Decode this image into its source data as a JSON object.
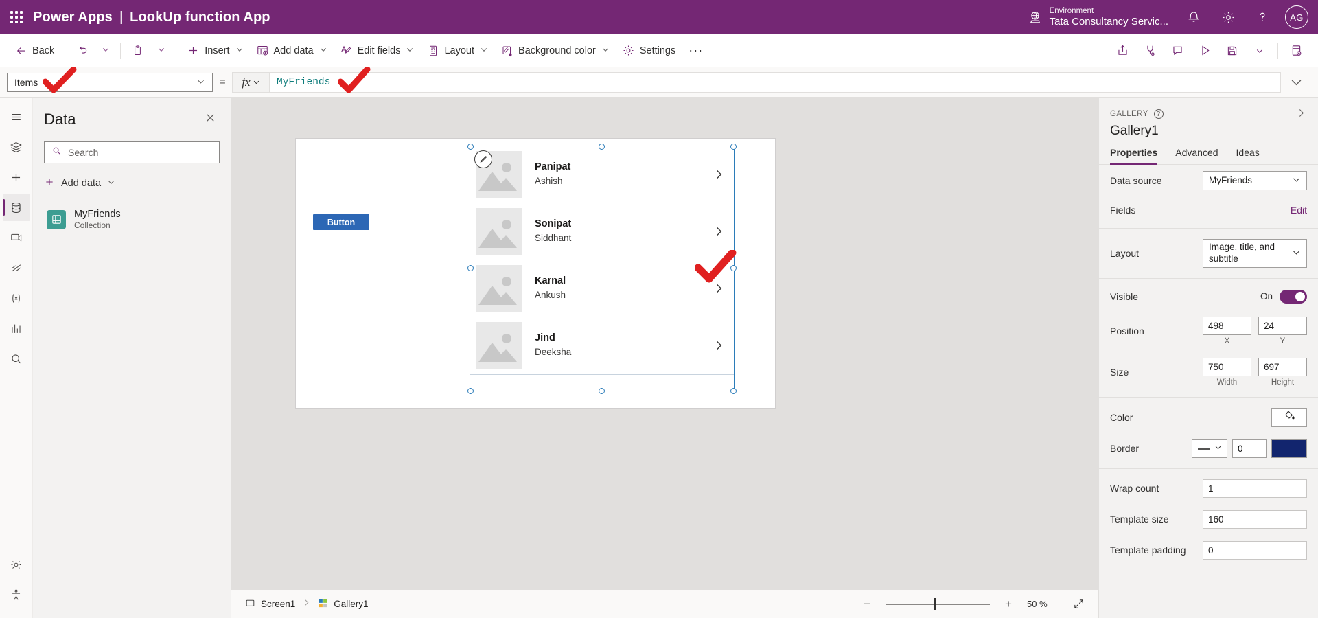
{
  "header": {
    "waffle": "app-launcher",
    "product": "Power Apps",
    "separator": "|",
    "app_name": "LookUp function App",
    "environment_label": "Environment",
    "environment_name": "Tata Consultancy Servic...",
    "avatar_initials": "AG",
    "brand_color": "#742774"
  },
  "ribbon": {
    "back": "Back",
    "items": [
      {
        "label": "Insert",
        "icon": "plus-icon",
        "caret": true
      },
      {
        "label": "Add data",
        "icon": "add-data-icon",
        "caret": true
      },
      {
        "label": "Edit fields",
        "icon": "edit-fields-icon",
        "caret": true
      },
      {
        "label": "Layout",
        "icon": "layout-icon",
        "caret": true
      },
      {
        "label": "Background color",
        "icon": "background-color-icon",
        "caret": true
      },
      {
        "label": "Settings",
        "icon": "settings-gear-icon",
        "caret": false
      }
    ],
    "overflow": "···"
  },
  "formula_bar": {
    "property": "Items",
    "equals": "=",
    "fx": "fx",
    "expression": "MyFriends"
  },
  "data_panel": {
    "title": "Data",
    "search_placeholder": "Search",
    "add_data": "Add data",
    "sources": [
      {
        "name": "MyFriends",
        "type": "Collection",
        "icon_color": "#3c9d92"
      }
    ]
  },
  "canvas": {
    "button_label": "Button",
    "gallery_items": [
      {
        "title": "Panipat",
        "subtitle": "Ashish"
      },
      {
        "title": "Sonipat",
        "subtitle": "Siddhant"
      },
      {
        "title": "Karnal",
        "subtitle": "Ankush"
      },
      {
        "title": "Jind",
        "subtitle": "Deeksha"
      }
    ]
  },
  "status_bar": {
    "screen": "Screen1",
    "control": "Gallery1",
    "zoom_out": "−",
    "zoom_in": "+",
    "zoom_value": "50",
    "zoom_unit": "%"
  },
  "properties_panel": {
    "kicker": "GALLERY",
    "name": "Gallery1",
    "tabs": [
      {
        "label": "Properties",
        "active": true
      },
      {
        "label": "Advanced",
        "active": false
      },
      {
        "label": "Ideas",
        "active": false
      }
    ],
    "data_source_label": "Data source",
    "data_source_value": "MyFriends",
    "fields_label": "Fields",
    "fields_action": "Edit",
    "layout_label": "Layout",
    "layout_value": "Image, title, and subtitle",
    "visible_label": "Visible",
    "visible_state": "On",
    "position_label": "Position",
    "position_x": "498",
    "position_y": "24",
    "position_x_cap": "X",
    "position_y_cap": "Y",
    "size_label": "Size",
    "size_width": "750",
    "size_height": "697",
    "size_width_cap": "Width",
    "size_height_cap": "Height",
    "color_label": "Color",
    "border_label": "Border",
    "border_width": "0",
    "border_color": "#12256e",
    "wrap_count_label": "Wrap count",
    "wrap_count_value": "1",
    "template_size_label": "Template size",
    "template_size_value": "160",
    "template_padding_label": "Template padding",
    "template_padding_value": "0"
  }
}
